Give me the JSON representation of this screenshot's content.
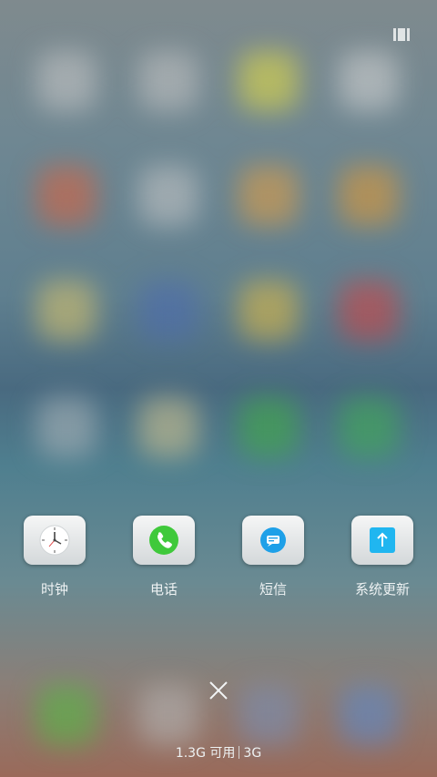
{
  "recents_icon": "recents-grid-icon",
  "apps": [
    {
      "label": "时钟",
      "icon": "clock-icon"
    },
    {
      "label": "电话",
      "icon": "phone-icon"
    },
    {
      "label": "短信",
      "icon": "sms-icon"
    },
    {
      "label": "系统更新",
      "icon": "system-update-icon"
    }
  ],
  "close_icon": "close-icon",
  "memory": {
    "available": "1.3G 可用",
    "total": "3G"
  },
  "colors": {
    "phone_green": "#3fc93b",
    "sms_blue": "#1ea0e8",
    "update_blue": "#20b6f0",
    "label_text": "#eef2f3"
  }
}
